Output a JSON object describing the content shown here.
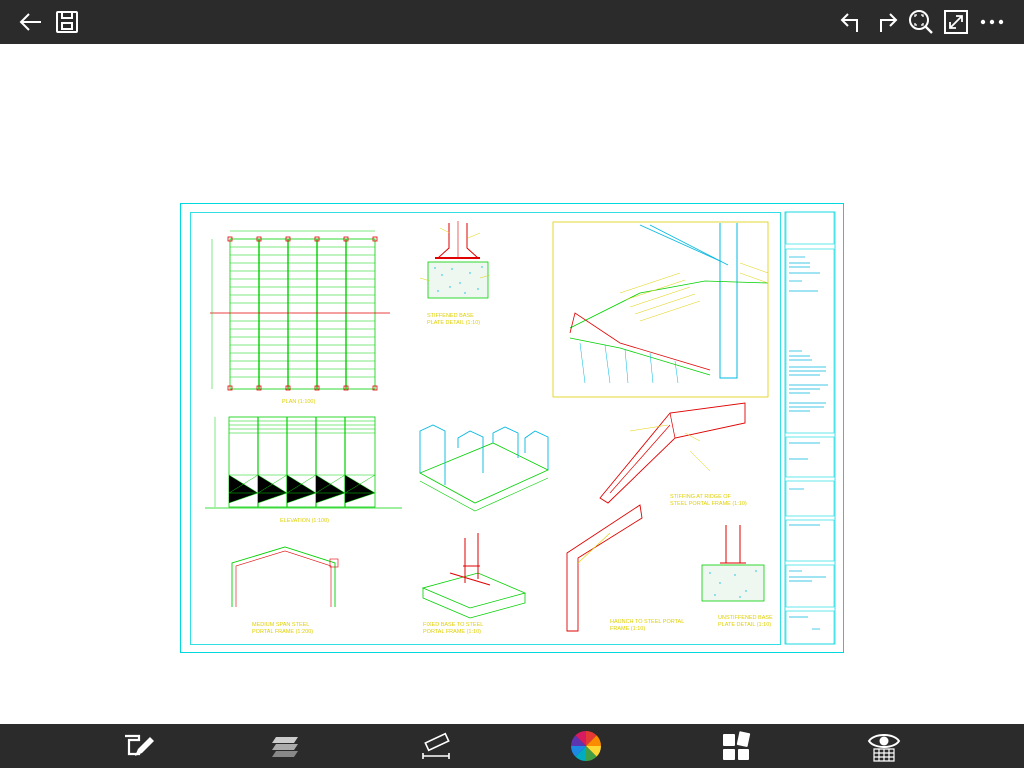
{
  "toolbar": {
    "left_icons": [
      "back-arrow-icon",
      "save-icon"
    ],
    "right_icons": [
      "undo-icon",
      "redo-icon",
      "zoom-extents-icon",
      "fullscreen-icon",
      "more-icon"
    ]
  },
  "bottom_toolbar": {
    "icons": [
      "markup-pen-icon",
      "layers-icon",
      "measure-icon",
      "color-wheel-icon",
      "layouts-icon",
      "visibility-icon"
    ]
  },
  "drawing": {
    "labels": {
      "plan": "PLAN (1:100)",
      "elevation": "ELEVATION (1:100)",
      "stiffened_base": "STIFFENED BASE",
      "stiffened_base_2": "PLATE DETAIL (1:10)",
      "ridge_1": "STIFFING AT RIDGE OF",
      "ridge_2": "STEEL PORTAL FRAME (1:10)",
      "medium_span_1": "MEDIUM SPAN STEEL",
      "medium_span_2": "PORTAL FRAME (1:200)",
      "fixed_base_1": "FIXED BASE TO STEEL",
      "fixed_base_2": "PORTAL FRAME (1:10)",
      "haunch_1": "HAUNCH TO STEEL PORTAL",
      "haunch_2": "FRAME (1:10)",
      "unstiffened_1": "UNSTIFFENED BASE",
      "unstiffened_2": "PLATE DETAIL (1:10)"
    },
    "colors": {
      "border": "#00d8e0",
      "green": "#00d000",
      "red": "#e00000",
      "yellow": "#e0d000",
      "accent_text": "#00b8e0"
    }
  }
}
